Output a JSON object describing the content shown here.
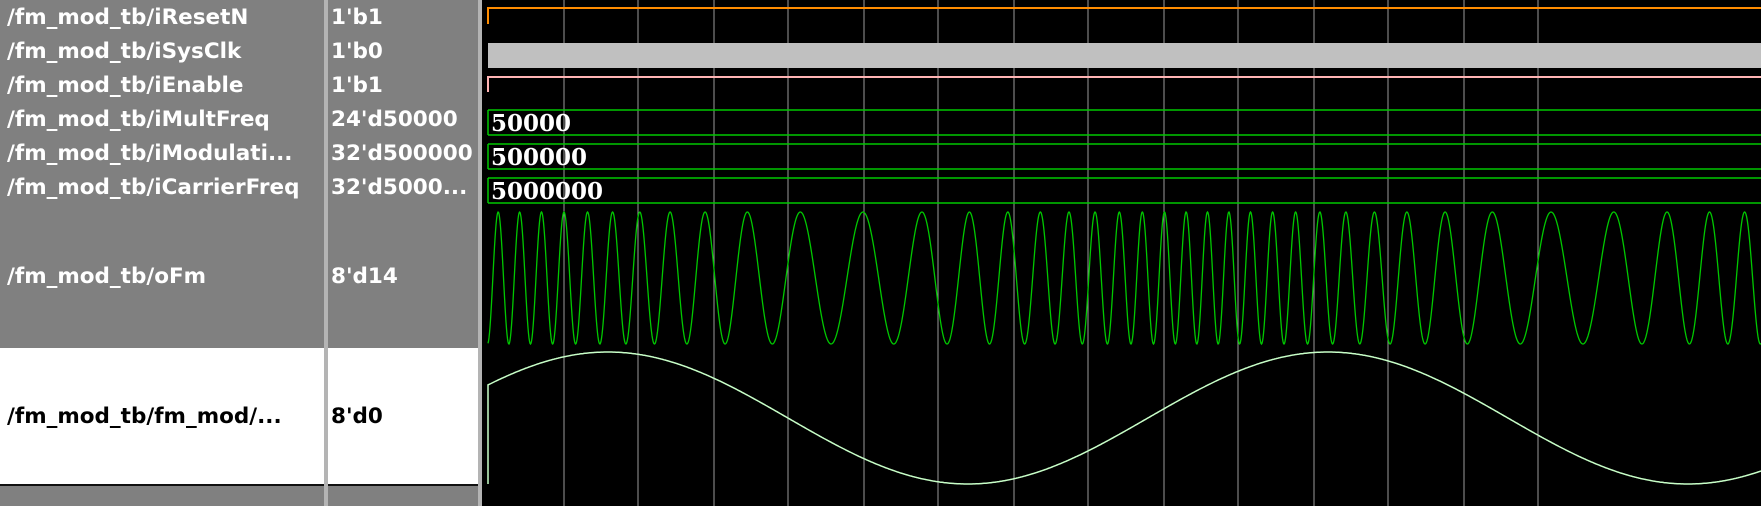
{
  "signals": [
    {
      "name": "/fm_mod_tb/iResetN",
      "value": "1'b1"
    },
    {
      "name": "/fm_mod_tb/iSysClk",
      "value": "1'b0"
    },
    {
      "name": "/fm_mod_tb/iEnable",
      "value": "1'b1"
    },
    {
      "name": "/fm_mod_tb/iMultFreq",
      "value": "24'd50000",
      "bus_label": "50000"
    },
    {
      "name": "/fm_mod_tb/iModulati...",
      "value": "32'd500000",
      "bus_label": "500000"
    },
    {
      "name": "/fm_mod_tb/iCarrierFreq",
      "value": "32'd5000...",
      "bus_label": "5000000"
    },
    {
      "name": "/fm_mod_tb/oFm",
      "value": "8'd14"
    },
    {
      "name": "/fm_mod_tb/fm_mod/...",
      "value": "8'd0",
      "selected": true
    }
  ],
  "colors": {
    "name_panel_bg": "#808080",
    "selected_row_bg": "#ffffff",
    "wave_bg": "#000000",
    "wave_green": "#00c800",
    "reset_orange": "#ff8c00",
    "clock_fill": "#c0c0c0",
    "enable_pink": "#ffb4b4",
    "selected_wave": "#c8ffc8",
    "grid_line": "#9a9a9a"
  }
}
